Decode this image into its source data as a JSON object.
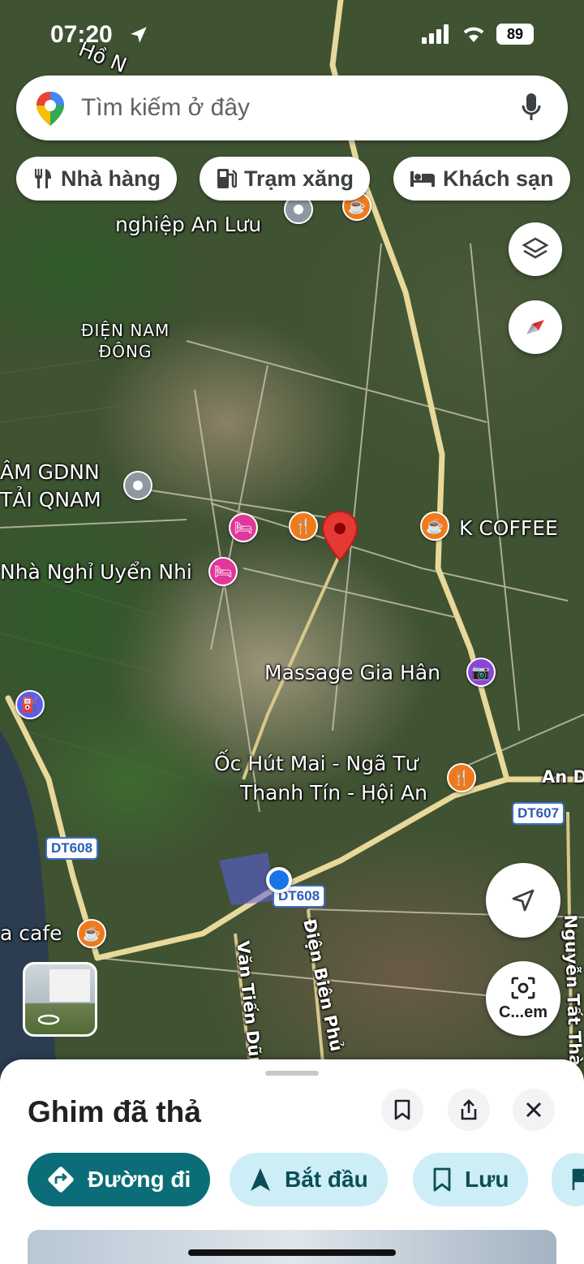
{
  "status_bar": {
    "time": "07:20",
    "battery": "89"
  },
  "search": {
    "placeholder": "Tìm kiếm ở đây"
  },
  "chips": [
    {
      "label": "Nhà hàng",
      "icon": "restaurant-icon"
    },
    {
      "label": "Trạm xăng",
      "icon": "gas-station-icon"
    },
    {
      "label": "Khách sạn",
      "icon": "hotel-icon"
    }
  ],
  "map": {
    "labels": {
      "top_road_fragment": "Hồ N",
      "industrial_zone": "nghiệp An Lưu",
      "district": "ĐIỆN NAM\nĐÔNG",
      "training_center": "ÂM GDNN\nTẢI QNAM",
      "guesthouse": "Nhà Nghỉ Uyển Nhi",
      "coffee": "K COFFEE",
      "massage": "Massage Gia Hân",
      "restaurant_line1": "Ốc Hút Mai - Ngã Tư",
      "restaurant_line2": "Thanh Tín - Hội An",
      "cafe": "a cafe",
      "road_an": "An D",
      "street_van_tien_dung": "Văn Tiến Dũn",
      "street_dien_bien_phu": "Điện Biên Phủ",
      "street_nguyen": "Nguyễn Tất Thà"
    },
    "route_shields": [
      "DT608",
      "DT608",
      "DT607"
    ],
    "pin_colors": {
      "restaurant": "#f07a1b",
      "hotel": "#e0389a",
      "landmark": "#8e44d8",
      "generic": "#8d98a3",
      "dropped": "#e53935",
      "my_location": "#1a73e8"
    }
  },
  "camera_button": {
    "label": "C...em"
  },
  "sheet": {
    "title": "Ghim đã thả",
    "actions": [
      {
        "label": "Đường đi",
        "icon": "directions-icon"
      },
      {
        "label": "Bắt đầu",
        "icon": "navigation-arrow-icon"
      },
      {
        "label": "Lưu",
        "icon": "bookmark-icon"
      }
    ]
  }
}
